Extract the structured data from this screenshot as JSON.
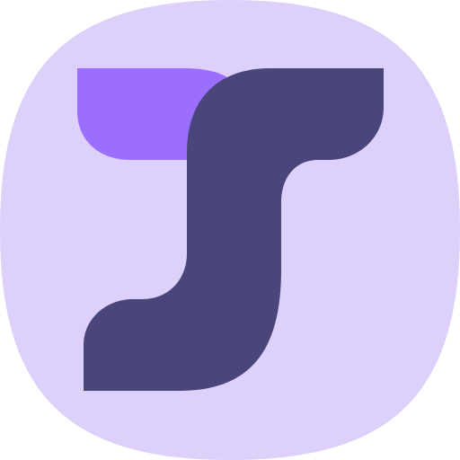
{
  "app_icon": {
    "icon_name": "app-logo-icon",
    "colors": {
      "background": "#DDD0FB",
      "accent": "#9C6EFD",
      "primary": "#4A457A"
    }
  }
}
